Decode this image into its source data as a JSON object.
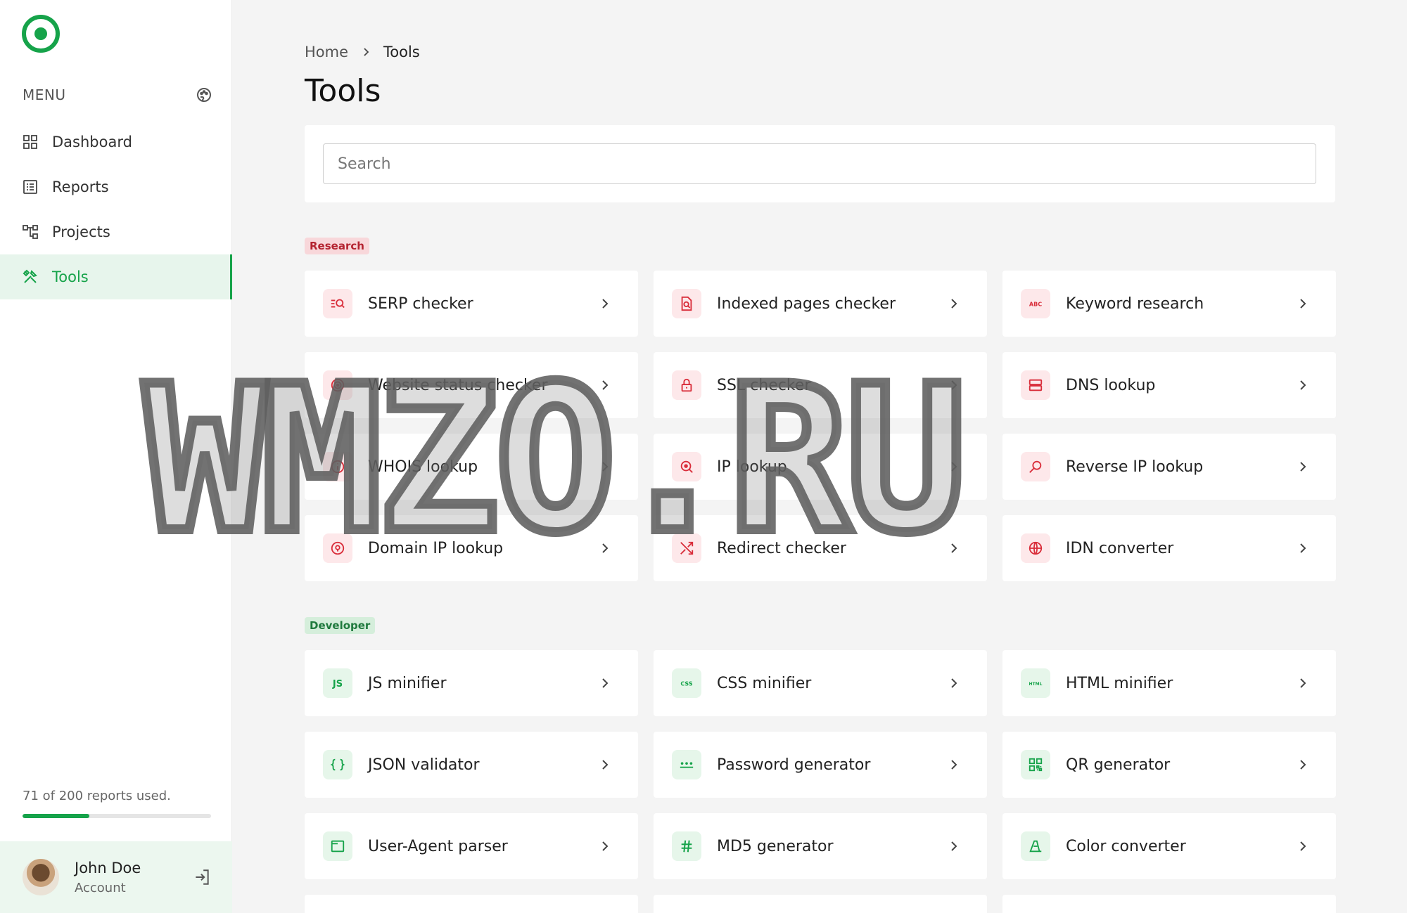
{
  "sidebar": {
    "menu_label": "MENU",
    "items": [
      {
        "label": "Dashboard",
        "icon": "grid-icon"
      },
      {
        "label": "Reports",
        "icon": "list-icon"
      },
      {
        "label": "Projects",
        "icon": "tree-icon"
      },
      {
        "label": "Tools",
        "icon": "tools-icon",
        "active": true
      }
    ],
    "usage_text": "71 of 200 reports used.",
    "usage_fraction": 0.355,
    "account": {
      "name": "John Doe",
      "sub": "Account"
    }
  },
  "breadcrumb": {
    "home": "Home",
    "current": "Tools"
  },
  "page_title": "Tools",
  "search": {
    "placeholder": "Search"
  },
  "sections": {
    "research": {
      "label": "Research",
      "items": [
        "SERP checker",
        "Indexed pages checker",
        "Keyword research",
        "Website status checker",
        "SSL checker",
        "DNS lookup",
        "WHOIS lookup",
        "IP lookup",
        "Reverse IP lookup",
        "Domain IP lookup",
        "Redirect checker",
        "IDN converter"
      ]
    },
    "developer": {
      "label": "Developer",
      "items": [
        "JS minifier",
        "CSS minifier",
        "HTML minifier",
        "JSON validator",
        "Password generator",
        "QR generator",
        "User-Agent parser",
        "MD5 generator",
        "Color converter"
      ]
    }
  },
  "colors": {
    "accent": "#16a34a",
    "research": "#d92d3a",
    "developer_tag": "#1f7a3d"
  },
  "watermark": "WMZO.RU"
}
